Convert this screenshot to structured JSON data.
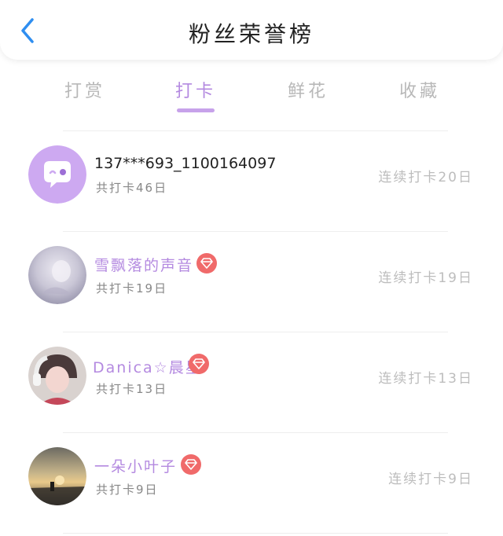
{
  "header": {
    "title": "粉丝荣誉榜",
    "back_icon": "chevron-left-icon",
    "accent": "#2f8ef0"
  },
  "tabs": [
    {
      "label": "打赏",
      "active": false
    },
    {
      "label": "打卡",
      "active": true
    },
    {
      "label": "鲜花",
      "active": false
    },
    {
      "label": "收藏",
      "active": false
    }
  ],
  "colors": {
    "tab_active": "#b48ae0",
    "tab_inactive": "#b8b8b8",
    "vip_name": "#b48ae0",
    "badge": "#f06a6a"
  },
  "list": [
    {
      "name": "137***693_1100164097",
      "total": "共打卡46日",
      "streak": "连续打卡20日",
      "vip": false,
      "avatar": "default-chat-avatar"
    },
    {
      "name": "雪飘落的声音",
      "total": "共打卡19日",
      "streak": "连续打卡19日",
      "vip": true,
      "avatar": "user-photo-avatar"
    },
    {
      "name": "Danica☆晨星",
      "total": "共打卡13日",
      "streak": "连续打卡13日",
      "vip": true,
      "avatar": "user-photo-avatar"
    },
    {
      "name": "一朵小叶子",
      "total": "共打卡9日",
      "streak": "连续打卡9日",
      "vip": true,
      "avatar": "user-photo-avatar"
    }
  ]
}
